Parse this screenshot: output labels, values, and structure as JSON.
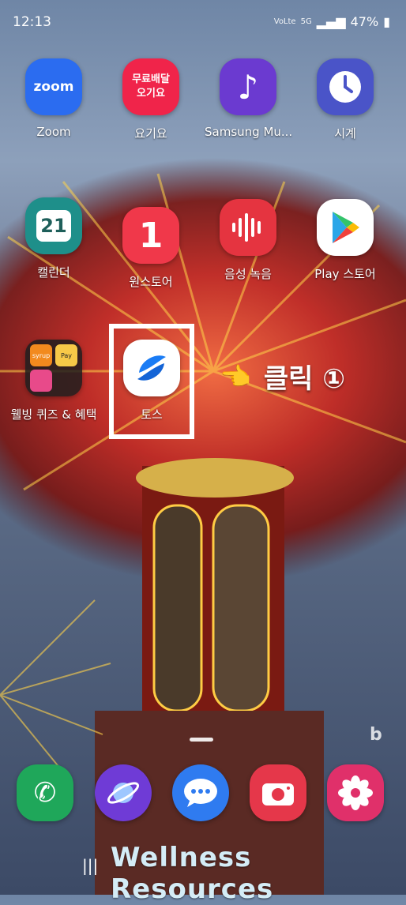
{
  "status": {
    "time": "12:13",
    "network": "VoLte",
    "gen": "5G",
    "battery": "47%"
  },
  "apps_row1": [
    {
      "label": "Zoom",
      "icon": "zoom-icon",
      "text": "zoom",
      "bg": "#2b6cf0"
    },
    {
      "label": "요기요",
      "icon": "yogiyo-icon",
      "text": "무료배달 오기요",
      "bg": "#f0244a"
    },
    {
      "label": "Samsung Mu...",
      "icon": "samsung-music-icon",
      "text": "",
      "bg": "#6b3ad0"
    },
    {
      "label": "시계",
      "icon": "clock-icon",
      "text": "",
      "bg": "#4a54c8"
    }
  ],
  "apps_row2": [
    {
      "label": "캘린더",
      "icon": "calendar-icon",
      "text": "21",
      "bg": "#1e8f8a"
    },
    {
      "label": "원스토어",
      "icon": "onestore-icon",
      "text": "1",
      "bg": "#f0384a"
    },
    {
      "label": "음성 녹음",
      "icon": "voice-recorder-icon",
      "text": "",
      "bg": "#e53440"
    },
    {
      "label": "Play 스토어",
      "icon": "play-store-icon",
      "text": "",
      "bg": "#ffffff"
    }
  ],
  "apps_row3": [
    {
      "label": "웰빙 퀴즈 & 혜택",
      "icon": "folder-icon",
      "text": "syrup KB Pay",
      "bg": "#2a2a2a"
    },
    {
      "label": "토스",
      "icon": "toss-icon",
      "text": "",
      "bg": "#ffffff"
    }
  ],
  "annotation": {
    "text": "클릭 ①",
    "pointer": "pointing-hand-icon"
  },
  "dock": [
    {
      "icon": "phone-icon",
      "bg": "#1fa75a"
    },
    {
      "icon": "internet-icon",
      "bg": "#6f3bd6"
    },
    {
      "icon": "messages-icon",
      "bg": "#2f7bf0"
    },
    {
      "icon": "camera-icon",
      "bg": "#e5374a"
    },
    {
      "icon": "gallery-icon",
      "bg": "#e0306a"
    }
  ],
  "watermark": "Wellness Resources",
  "nav": "|||",
  "bing": "b"
}
